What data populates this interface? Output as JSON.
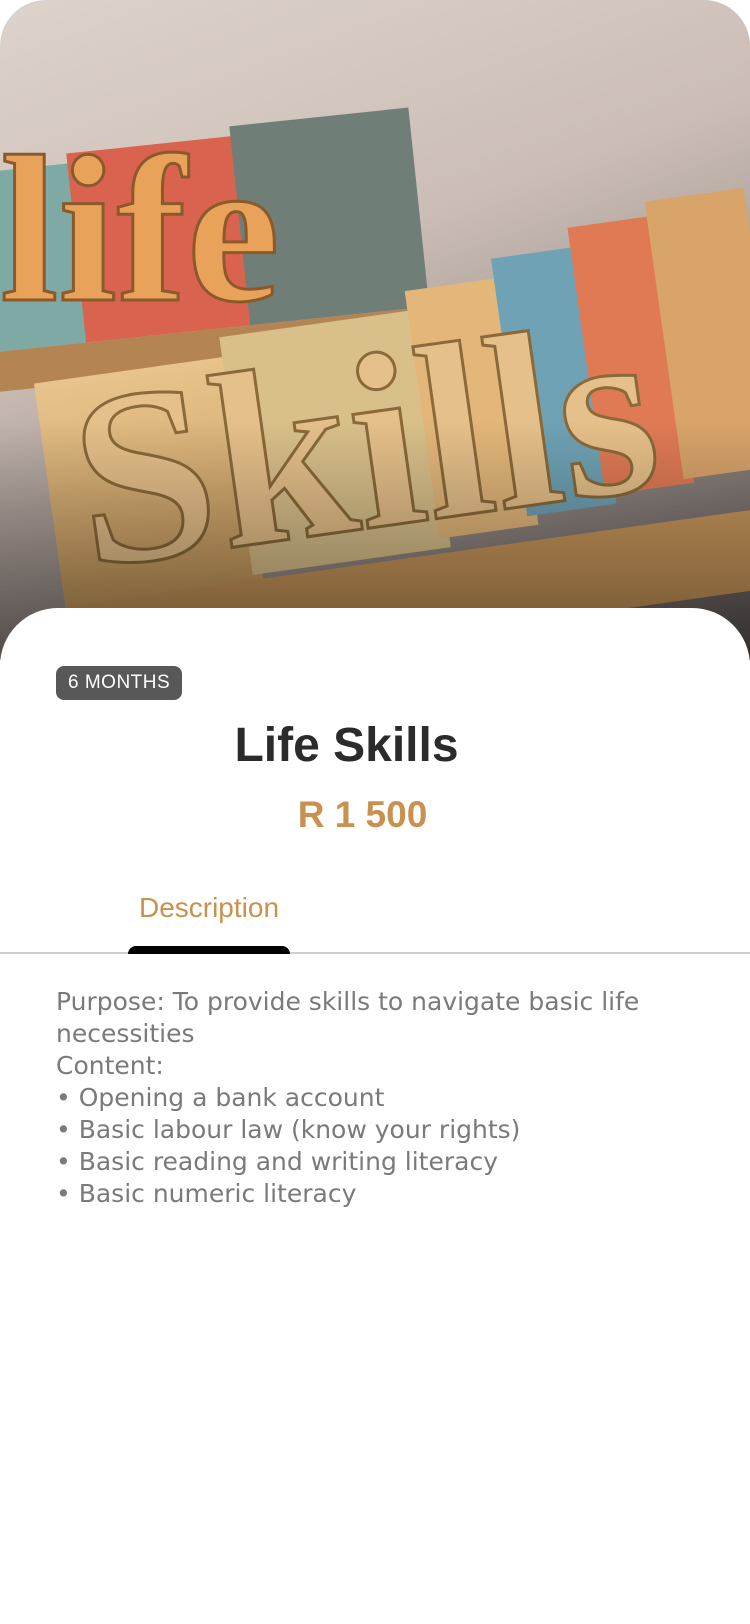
{
  "hero": {
    "image_name": "life-skills-letterpress-image",
    "word1": "life",
    "word2": "Skills"
  },
  "course": {
    "duration_badge": "6 MONTHS",
    "title": "Life Skills",
    "price": "R 1 500"
  },
  "tabs": [
    {
      "label": "Description",
      "active": true
    }
  ],
  "description": {
    "purpose": "Purpose: To provide skills to navigate basic life necessities",
    "content_heading": "Content:",
    "items": [
      "• Opening a bank account",
      "• Basic labour law (know your rights)",
      "• Basic reading and writing literacy",
      "• Basic numeric literacy"
    ]
  },
  "colors": {
    "accent": "#c9914f",
    "badge_bg": "#585858",
    "title_text": "#2b2b2b",
    "body_text": "#7a7a7a",
    "tab_indicator": "#000000"
  }
}
